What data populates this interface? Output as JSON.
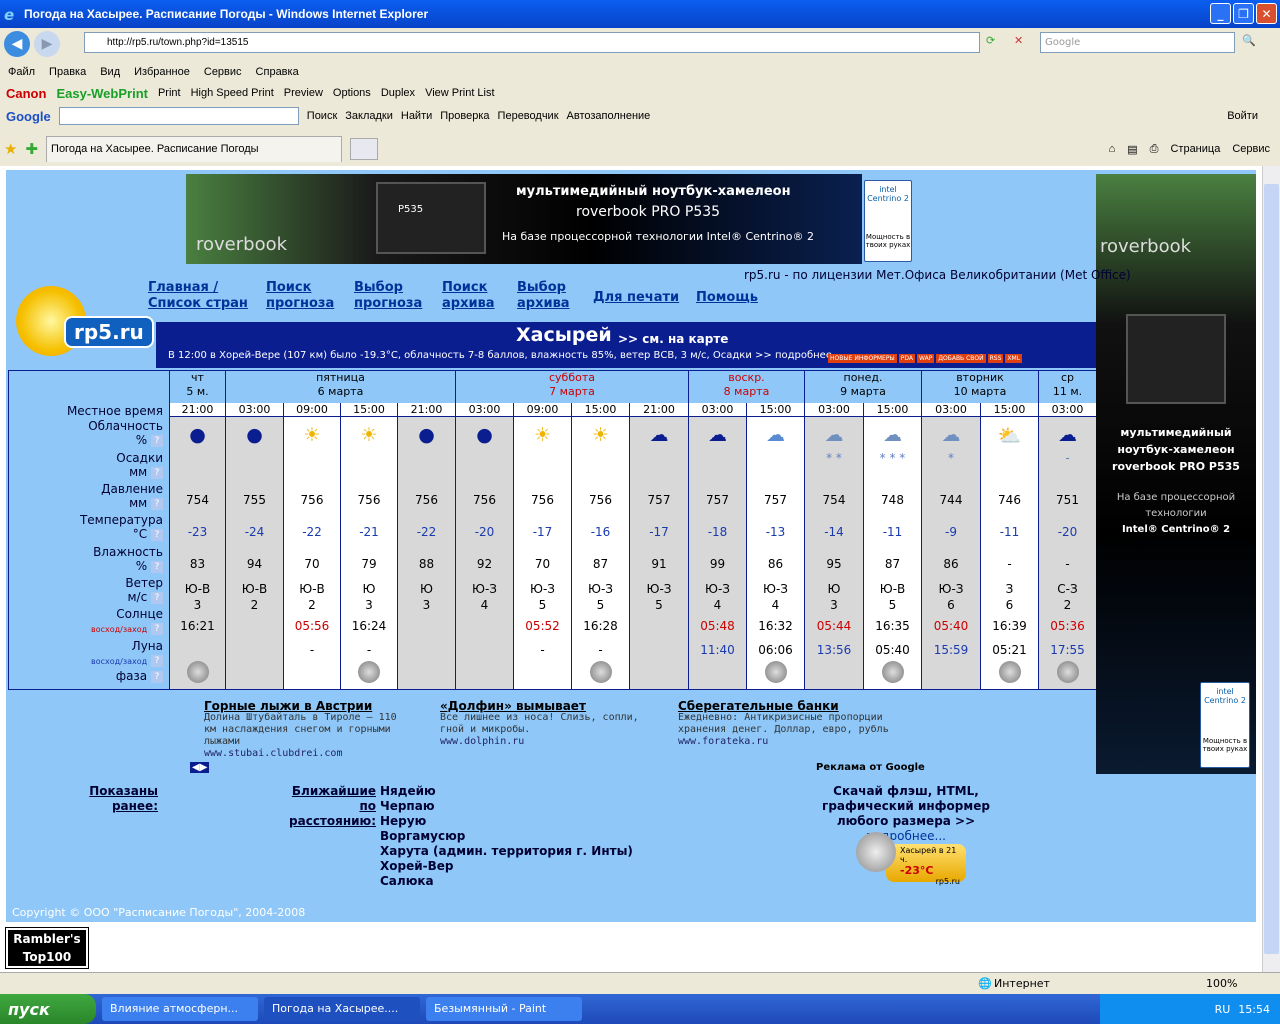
{
  "window": {
    "title": "Погода на Хасырее. Расписание Погоды - Windows Internet Explorer"
  },
  "address": {
    "url": "http://rp5.ru/town.php?id=13515",
    "search_placeholder": "Google"
  },
  "menu": [
    "Файл",
    "Правка",
    "Вид",
    "Избранное",
    "Сервис",
    "Справка"
  ],
  "canon": {
    "brand": "Canon",
    "product": "Easy-WebPrint",
    "items": [
      "Print",
      "High Speed Print",
      "Preview",
      "Options",
      "Duplex",
      "View Print List"
    ]
  },
  "googlebar": {
    "logo": "Google",
    "items": [
      "Поиск",
      "Закладки",
      "Найти",
      "Проверка",
      "Переводчик",
      "Автозаполнение",
      "Войти"
    ]
  },
  "tab": {
    "label": "Погода на Хасырее. Расписание Погоды"
  },
  "cmdbar": {
    "page": "Страница",
    "tools": "Сервис"
  },
  "ad_top": {
    "brand": "roverbook",
    "title": "мультимедийный ноутбук-хамелеон",
    "model": "roverbook PRO P535",
    "tech": "На базе процессорной технологии Intel® Centrino® 2",
    "intel": "intel Centrino 2",
    "intel_note": "Мощность в твоих руках",
    "screen": "P535"
  },
  "ad_side": {
    "brand": "roverbook",
    "l1": "мультимедийный ноутбук-хамелеон",
    "l2": "roverbook PRO P535",
    "l3": "На базе процессорной технологии",
    "l4": "Intel® Centrino® 2"
  },
  "licence": "rp5.ru - по лицензии Мет.Офиса Великобритании (Met Office)",
  "logo": "rp5.ru",
  "nav": [
    {
      "l1": "Главная /",
      "l2": "Список стран"
    },
    {
      "l1": "Поиск",
      "l2": "прогноза"
    },
    {
      "l1": "Выбор",
      "l2": "прогноза"
    },
    {
      "l1": "Поиск",
      "l2": "архива"
    },
    {
      "l1": "Выбор",
      "l2": "архива"
    },
    {
      "l1": "Для печати",
      "l2": ""
    },
    {
      "l1": "Помощь",
      "l2": ""
    }
  ],
  "town": {
    "name": "Хасырей",
    "map": ">> см. на карте",
    "obs": "В 12:00 в Хорей-Вере (107 км) было -19.3°C, облачность 7-8 баллов, влажность 85%, ветер ВСВ, 3 м/с, Осадки >> подробнее...",
    "badges": [
      "НОВЫЕ ИНФОРМЕРЫ",
      "PDA",
      "WAP",
      "ДОБАВЬ СВОЙ",
      "RSS",
      "XML"
    ]
  },
  "labels": {
    "local_time": "Местное время",
    "clouds": "Облачность",
    "clouds_u": "%",
    "precip": "Осадки",
    "precip_u": "мм",
    "pressure": "Давление",
    "pressure_u": "мм",
    "temp": "Температура",
    "temp_u": "°C",
    "humidity": "Влажность",
    "humidity_u": "%",
    "wind": "Ветер",
    "wind_u": "м/с",
    "sun": "Солнце",
    "sun_u": "восход/заход",
    "moon": "Луна",
    "moon_u": "восход/заход",
    "phase": "фаза"
  },
  "days": [
    {
      "name": "чт",
      "date": "5 м.",
      "color": "#000"
    },
    {
      "name": "пятница",
      "date": "6 марта",
      "color": "#000"
    },
    {
      "name": "суббота",
      "date": "7 марта",
      "color": "#c00"
    },
    {
      "name": "воскр.",
      "date": "8 марта",
      "color": "#c00"
    },
    {
      "name": "понед.",
      "date": "9 марта",
      "color": "#000"
    },
    {
      "name": "вторник",
      "date": "10 марта",
      "color": "#000"
    },
    {
      "name": "ср",
      "date": "11 м.",
      "color": "#000"
    }
  ],
  "cols": [
    {
      "t": "21:00",
      "icon": "night-clear-icon",
      "pr": "",
      "p": "754",
      "tc": "-23",
      "h": "83",
      "wd": "Ю-В",
      "ws": "3",
      "sun": "16:21",
      "sunc": "#000",
      "moon": "",
      "moonc": "#000",
      "ph": true
    },
    {
      "t": "03:00",
      "icon": "night-clear-icon",
      "pr": "",
      "p": "755",
      "tc": "-24",
      "h": "94",
      "wd": "Ю-В",
      "ws": "2",
      "sun": "",
      "sunc": "#000",
      "moon": "",
      "moonc": "#000",
      "ph": false
    },
    {
      "t": "09:00",
      "icon": "sunny-icon",
      "pr": "",
      "p": "756",
      "tc": "-22",
      "h": "70",
      "wd": "Ю-В",
      "ws": "2",
      "sun": "05:56",
      "sunc": "#c00",
      "moon": "-",
      "moonc": "#000",
      "ph": false
    },
    {
      "t": "15:00",
      "icon": "sunny-icon",
      "pr": "",
      "p": "756",
      "tc": "-21",
      "h": "79",
      "wd": "Ю",
      "ws": "3",
      "sun": "16:24",
      "sunc": "#000",
      "moon": "-",
      "moonc": "#000",
      "ph": true
    },
    {
      "t": "21:00",
      "icon": "night-clear-icon",
      "pr": "",
      "p": "756",
      "tc": "-22",
      "h": "88",
      "wd": "Ю",
      "ws": "3",
      "sun": "",
      "sunc": "#000",
      "moon": "",
      "moonc": "#000",
      "ph": false
    },
    {
      "t": "03:00",
      "icon": "night-clear-icon",
      "pr": "",
      "p": "756",
      "tc": "-20",
      "h": "92",
      "wd": "Ю-З",
      "ws": "4",
      "sun": "",
      "sunc": "#000",
      "moon": "",
      "moonc": "#000",
      "ph": false
    },
    {
      "t": "09:00",
      "icon": "sunny-icon",
      "pr": "",
      "p": "756",
      "tc": "-17",
      "h": "70",
      "wd": "Ю-З",
      "ws": "5",
      "sun": "05:52",
      "sunc": "#c00",
      "moon": "-",
      "moonc": "#000",
      "ph": false
    },
    {
      "t": "15:00",
      "icon": "sunny-icon",
      "pr": "",
      "p": "756",
      "tc": "-16",
      "h": "87",
      "wd": "Ю-З",
      "ws": "5",
      "sun": "16:28",
      "sunc": "#000",
      "moon": "-",
      "moonc": "#000",
      "ph": true
    },
    {
      "t": "21:00",
      "icon": "night-cloudy-icon",
      "pr": "",
      "p": "757",
      "tc": "-17",
      "h": "91",
      "wd": "Ю-З",
      "ws": "5",
      "sun": "",
      "sunc": "#000",
      "moon": "",
      "moonc": "#000",
      "ph": false
    },
    {
      "t": "03:00",
      "icon": "night-cloudy-icon",
      "pr": "",
      "p": "757",
      "tc": "-18",
      "h": "99",
      "wd": "Ю-З",
      "ws": "4",
      "sun": "05:48",
      "sunc": "#c00",
      "moon": "11:40",
      "moonc": "#1a3ab0",
      "ph": false
    },
    {
      "t": "15:00",
      "icon": "overcast-icon",
      "pr": "",
      "p": "757",
      "tc": "-13",
      "h": "86",
      "wd": "Ю-З",
      "ws": "4",
      "sun": "16:32",
      "sunc": "#000",
      "moon": "06:06",
      "moonc": "#000",
      "ph": true
    },
    {
      "t": "03:00",
      "icon": "snow-cloud-icon",
      "pr": "* *",
      "p": "754",
      "tc": "-14",
      "h": "95",
      "wd": "Ю",
      "ws": "3",
      "sun": "05:44",
      "sunc": "#c00",
      "moon": "13:56",
      "moonc": "#1a3ab0",
      "ph": false
    },
    {
      "t": "15:00",
      "icon": "snow-cloud-icon",
      "pr": "* * *",
      "p": "748",
      "tc": "-11",
      "h": "87",
      "wd": "Ю-В",
      "ws": "5",
      "sun": "16:35",
      "sunc": "#000",
      "moon": "05:40",
      "moonc": "#000",
      "ph": true
    },
    {
      "t": "03:00",
      "icon": "snow-cloud-icon",
      "pr": "*",
      "p": "744",
      "tc": "-9",
      "h": "86",
      "wd": "Ю-З",
      "ws": "6",
      "sun": "05:40",
      "sunc": "#c00",
      "moon": "15:59",
      "moonc": "#1a3ab0",
      "ph": false
    },
    {
      "t": "15:00",
      "icon": "sun-cloud-icon",
      "pr": "",
      "p": "746",
      "tc": "-11",
      "h": "-",
      "wd": "З",
      "ws": "6",
      "sun": "16:39",
      "sunc": "#000",
      "moon": "05:21",
      "moonc": "#000",
      "ph": true
    },
    {
      "t": "03:00",
      "icon": "night-cloudy-icon",
      "pr": "-",
      "p": "751",
      "tc": "-20",
      "h": "-",
      "wd": "С-З",
      "ws": "2",
      "sun": "05:36",
      "sunc": "#c00",
      "moon": "17:55",
      "moonc": "#1a3ab0",
      "ph": true
    }
  ],
  "ads": [
    {
      "h": "Горные лыжи в Австрии",
      "t": "Долина Штубайталь в Тироле – 110 км наслаждения снегом и горными лыжами",
      "u": "www.stubai.clubdrei.com"
    },
    {
      "h": "«Долфин» вымывает",
      "t": "Все лишнее из носа! Слизь, сопли, гной и микробы.",
      "u": "www.dolphin.ru"
    },
    {
      "h": "Сберегательные банки",
      "t": "Ежедневно: Антикризисные пропорции хранения денег. Доллар, евро, рубль",
      "u": "www.forateka.ru"
    }
  ],
  "ads_by": "Реклама от Google",
  "shown_before": "Показаны ранее:",
  "nearest_label": "Ближайшие по расстоянию:",
  "nearest": [
    "Нядейю",
    "Черпаю",
    "Нерую",
    "Воргамусюр",
    "Харута (админ. территория г. Инты)",
    "Хорей-Вер",
    "Салюка"
  ],
  "informer": {
    "l1": "Скачай флэш, HTML,",
    "l2": "графический информер",
    "l3": "любого размера >> ",
    "more": "подробнее...",
    "place": "Хасырей в 21 ч.",
    "temp": "-23°C",
    "site": "rp5.ru"
  },
  "copyright": "Copyright © ООО \"Расписание Погоды\", 2004-2008",
  "rambler": {
    "l1": "Rambler's",
    "l2": "Top100"
  },
  "status": {
    "zone": "Интернет",
    "zoom": "100%"
  },
  "taskbar": {
    "start": "пуск",
    "tasks": [
      "Влияние атмосферн...",
      "Погода на Хасырее....",
      "Безымянный - Paint"
    ],
    "lang": "RU",
    "time": "15:54"
  }
}
